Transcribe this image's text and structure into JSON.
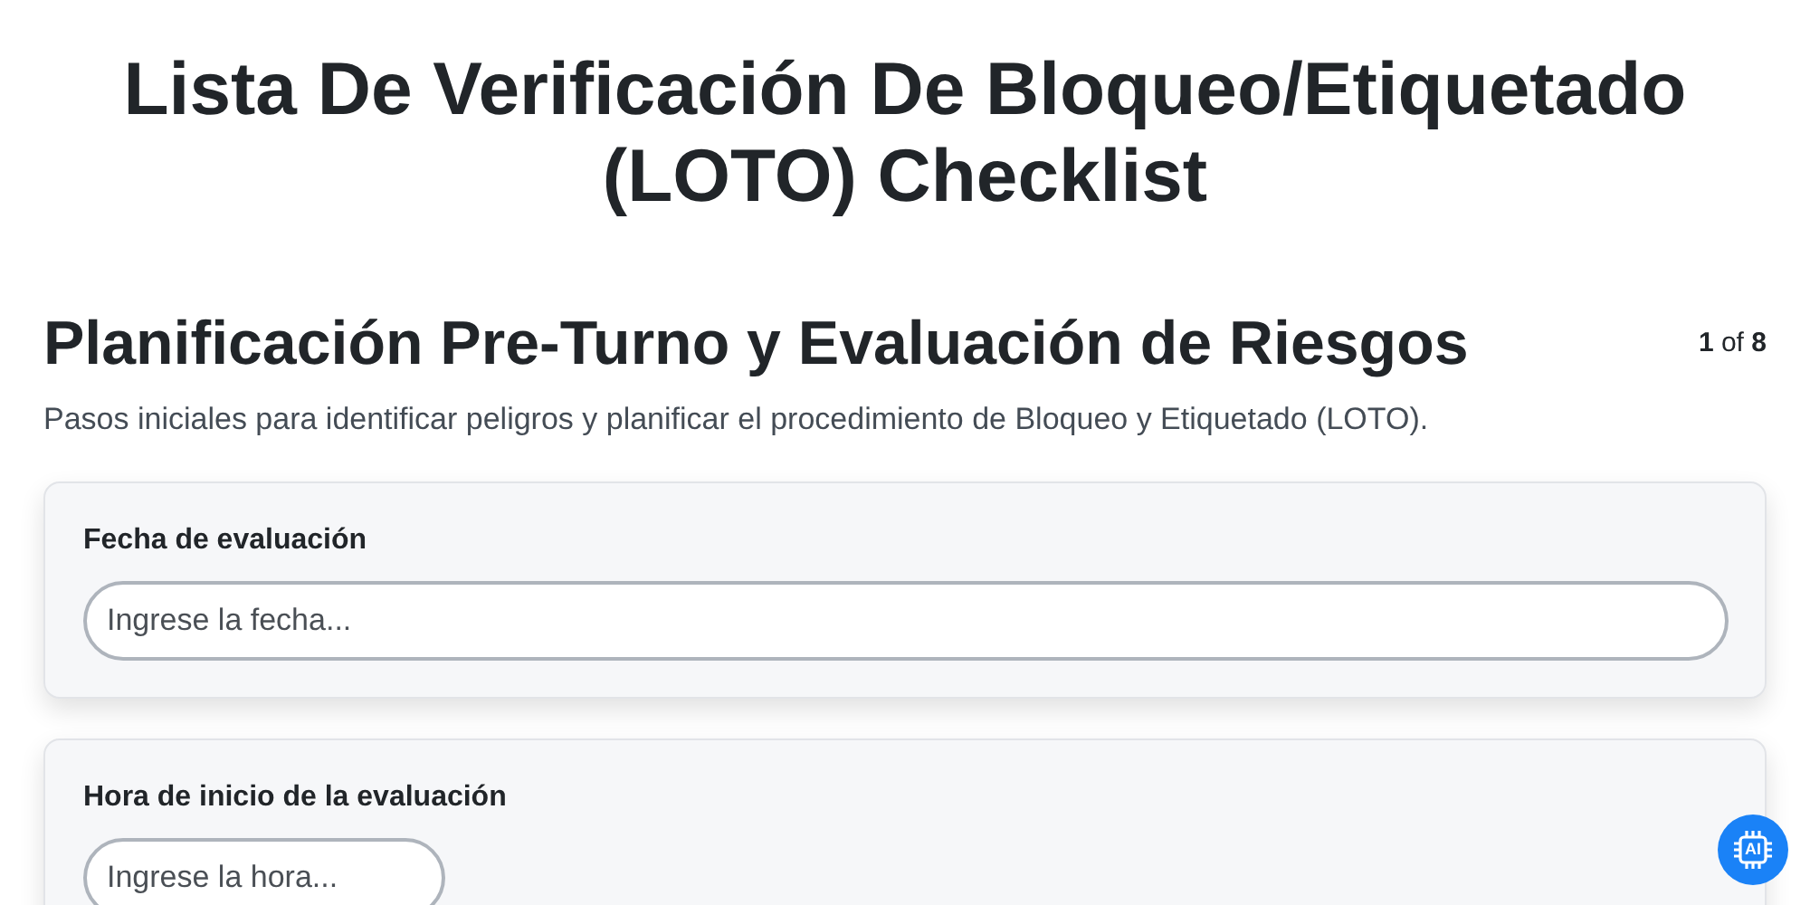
{
  "title": "Lista De Verificación De Bloqueo/Etiquetado (LOTO) Checklist",
  "section": {
    "heading": "Planificación Pre-Turno y Evaluación de Riesgos",
    "progress": "**1** of **8**",
    "description": "Pasos iniciales para identificar peligros y planificar el procedimiento de Bloqueo y Etiquetado (LOTO)."
  },
  "questions": [
    {
      "label": "Fecha de evaluación",
      "placeholder": "Ingrese la fecha...",
      "kind": "wide"
    },
    {
      "label": "Hora de inicio de la evaluación",
      "placeholder": "Ingrese la hora...",
      "kind": "short"
    }
  ],
  "assistant_button": {
    "label": "AI"
  }
}
